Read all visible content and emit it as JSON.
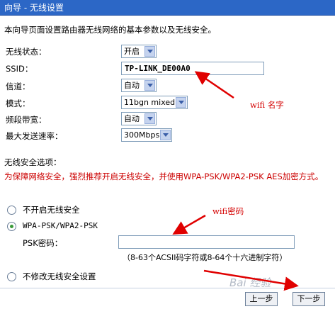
{
  "header": {
    "title": "向导 - 无线设置"
  },
  "intro": "本向导页面设置路由器无线网络的基本参数以及无线安全。",
  "form": {
    "wireless_status": {
      "label": "无线状态：",
      "value": "开启"
    },
    "ssid": {
      "label": "SSID：",
      "value": "TP-LINK_DE00A0"
    },
    "channel": {
      "label": "信道：",
      "value": "自动"
    },
    "mode": {
      "label": "模式：",
      "value": "11bgn mixed"
    },
    "bandwidth": {
      "label": "频段带宽：",
      "value": "自动"
    },
    "max_rate": {
      "label": "最大发送速率：",
      "value": "300Mbps"
    }
  },
  "security": {
    "title": "无线安全选项：",
    "warning": "为保障网络安全，强烈推荐开启无线安全，并使用WPA-PSK/WPA2-PSK AES加密方式。",
    "opt_none": "不开启无线安全",
    "opt_wpa": "WPA-PSK/WPA2-PSK",
    "psk_label": "PSK密码：",
    "psk_value": "",
    "hint": "（8-63个ACSII码字符或8-64个十六进制字符）",
    "opt_keep": "不修改无线安全设置",
    "selected": "wpa"
  },
  "buttons": {
    "prev": "上一步",
    "next": "下一步"
  },
  "annotations": {
    "wifi_name": "wifi 名字",
    "wifi_password": "wifi密码"
  },
  "watermark": "Bai 经验",
  "colors": {
    "header_bg": "#2c67c6",
    "warning": "#cc0000",
    "annotation": "#d40000"
  }
}
